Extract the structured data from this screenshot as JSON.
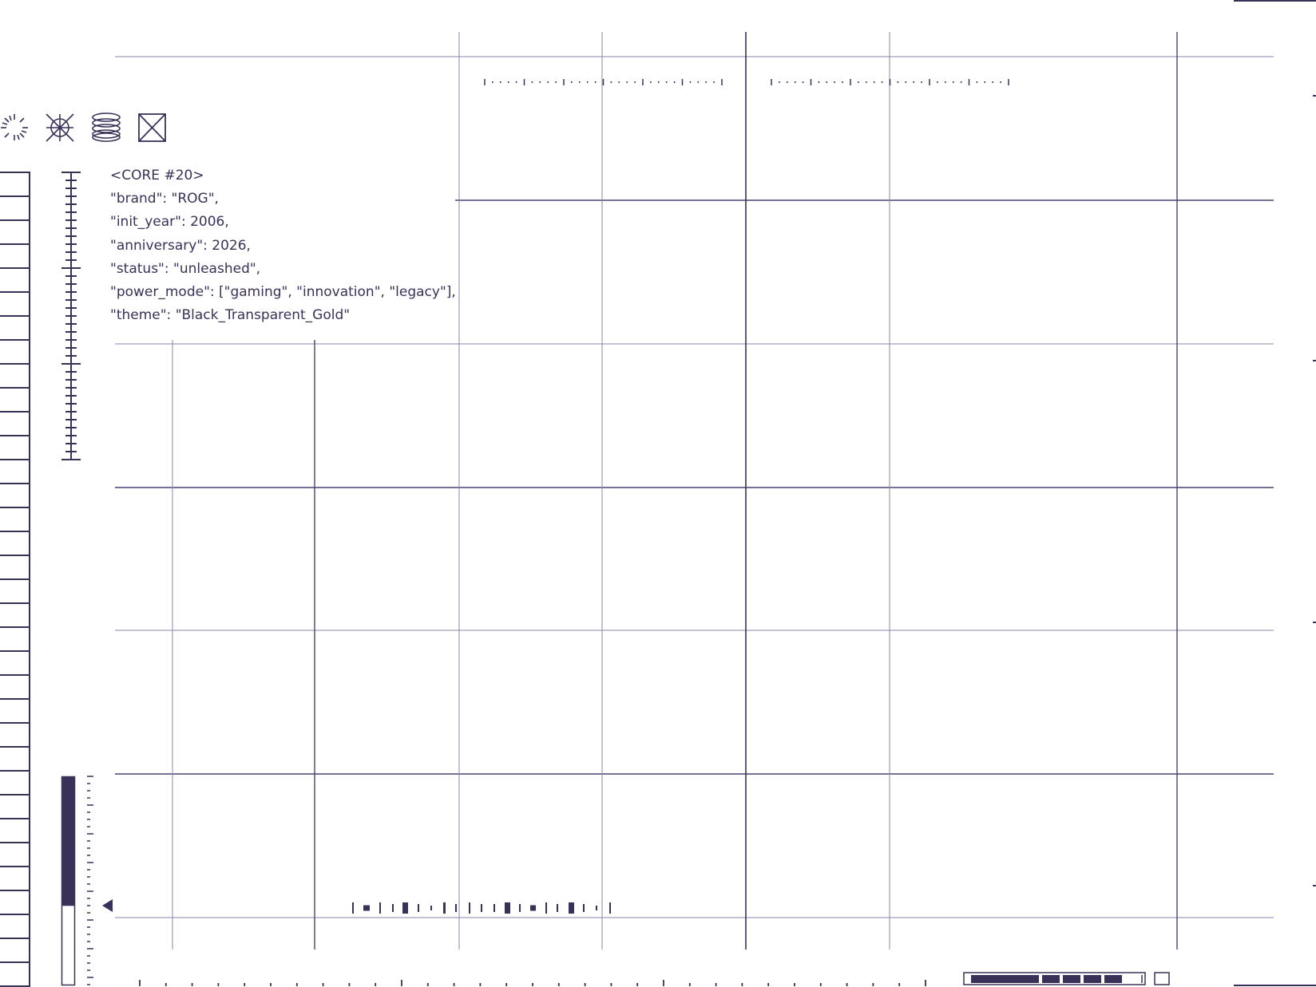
{
  "theme_colors": {
    "accent": "#3a3158",
    "grid_line": "#8a86a8",
    "background": "#ffffff"
  },
  "core_panel": {
    "lines": [
      "<CORE #20>",
      "\"brand\": \"ROG\",",
      "\"init_year\": 2006,",
      "\"anniversary\": 2026,",
      "\"status\": \"unleashed\",",
      "\"power_mode\": [\"gaming\", \"innovation\", \"legacy\"],",
      "\"theme\": \"Black_Transparent_Gold\""
    ]
  },
  "toolbar_icons": [
    "sunburst-icon",
    "asterisk-circle-icon",
    "stacked-rings-icon",
    "crossed-box-icon"
  ],
  "level_meter": {
    "fill_fraction": 0.62
  },
  "bottom_progress": {
    "segments_filled": 5,
    "segments_total": 6
  }
}
